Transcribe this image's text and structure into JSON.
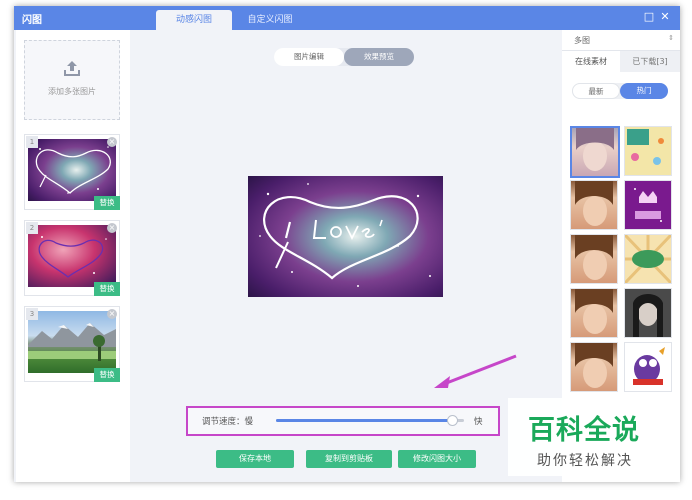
{
  "titlebar": {
    "app_title": "闪图",
    "tabs": [
      "动感闪图",
      "自定义闪图"
    ],
    "maximize": "□",
    "close": "✕"
  },
  "left_panel": {
    "add_label": "添加多张图片",
    "thumbs": [
      {
        "index": "1",
        "close": "×",
        "replace_label": "替换"
      },
      {
        "index": "2",
        "close": "×",
        "replace_label": "替换"
      },
      {
        "index": "3",
        "close": "×",
        "replace_label": "替换"
      }
    ]
  },
  "center": {
    "mode_tabs": [
      "图片编辑",
      "效果预览"
    ],
    "speed_label": "调节速度：慢",
    "speed_fast": "快",
    "speed_level": 0.93,
    "buttons": [
      "保存本地",
      "复制到剪贴板",
      "修改闪图大小"
    ]
  },
  "right_panel": {
    "category": "多图",
    "category_arrow": "⇕",
    "tabs": [
      "在线素材",
      "已下载[3]"
    ],
    "filters": [
      "最新",
      "热门"
    ]
  },
  "watermark": {
    "title": "百科全说",
    "subtitle": "助你轻松解决"
  },
  "colors": {
    "accent": "#5a86e6",
    "green": "#3cbc86",
    "highlight": "#c646c9",
    "watermark_green": "#1aa95a"
  }
}
